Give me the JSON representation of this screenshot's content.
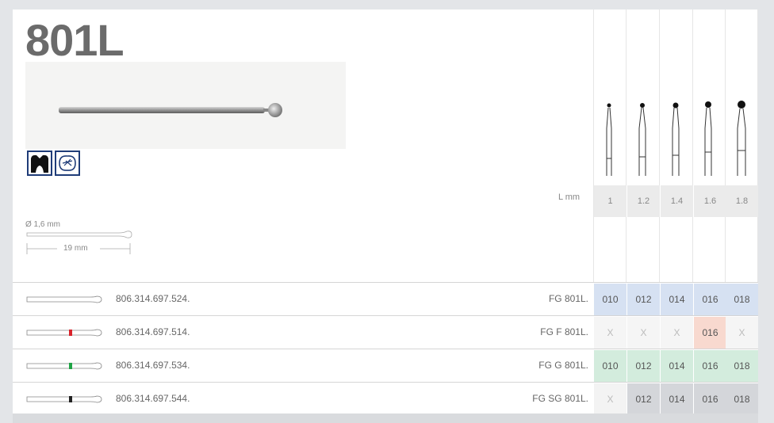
{
  "product": {
    "title": "801L",
    "diameter_label": "Ø 1,6 mm",
    "length_label": "19 mm"
  },
  "sizes": {
    "header_label": "L mm",
    "lengths": [
      "1",
      "1.2",
      "1.4",
      "1.6",
      "1.8"
    ]
  },
  "icons": [
    "tooth-crown-icon",
    "cavity-drill-icon"
  ],
  "rows": [
    {
      "code": "806.314.697.524.",
      "ref": "FG 801L.",
      "stripe": "none",
      "color": "#d6e1f2",
      "cells": [
        "010",
        "012",
        "014",
        "016",
        "018"
      ]
    },
    {
      "code": "806.314.697.514.",
      "ref": "FG F 801L.",
      "stripe": "#d9232b",
      "color": "#f5f5f5",
      "cells": [
        "X",
        "X",
        "X",
        "016",
        "X"
      ]
    },
    {
      "code": "806.314.697.534.",
      "ref": "FG G 801L.",
      "stripe": "#1fa345",
      "color": "#d3ecdd",
      "cells": [
        "010",
        "012",
        "014",
        "016",
        "018"
      ]
    },
    {
      "code": "806.314.697.544.",
      "ref": "FG SG 801L.",
      "stripe": "#222222",
      "color": "#d4d6da",
      "cells": [
        "X",
        "012",
        "014",
        "016",
        "018"
      ]
    }
  ],
  "highlight_color": "#f8d9cf"
}
